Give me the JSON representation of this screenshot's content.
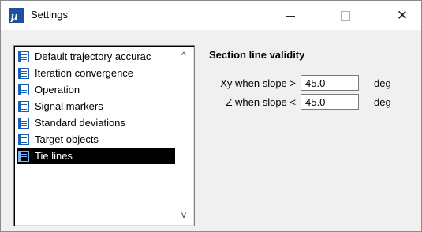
{
  "window": {
    "title": "Settings",
    "icon": "mu-app-icon",
    "controls": {
      "minimize": "minimize-icon",
      "maximize": "maximize-icon",
      "close": "close-icon",
      "close_glyph": "✕"
    }
  },
  "tree": {
    "items": [
      {
        "label": "Default trajectory accurac",
        "icon": "list-document-icon",
        "selected": false
      },
      {
        "label": "Iteration convergence",
        "icon": "list-document-icon",
        "selected": false
      },
      {
        "label": "Operation",
        "icon": "list-document-icon",
        "selected": false
      },
      {
        "label": "Signal markers",
        "icon": "list-document-icon",
        "selected": false
      },
      {
        "label": "Standard deviations",
        "icon": "list-document-icon",
        "selected": false
      },
      {
        "label": "Target objects",
        "icon": "list-document-icon",
        "selected": false
      },
      {
        "label": "Tie lines",
        "icon": "list-document-icon",
        "selected": true
      }
    ],
    "scroll_up_glyph": "^",
    "scroll_down_glyph": "v"
  },
  "panel": {
    "title": "Section line validity",
    "rows": [
      {
        "label": "Xy when slope >",
        "value": "45.0",
        "unit": "deg"
      },
      {
        "label": "Z when slope <",
        "value": "45.0",
        "unit": "deg"
      }
    ]
  },
  "colors": {
    "selection_bg": "#000000",
    "selection_text": "#ffffff",
    "icon_blue": "#1560b8",
    "app_icon_blue": "#1f4fa0"
  }
}
